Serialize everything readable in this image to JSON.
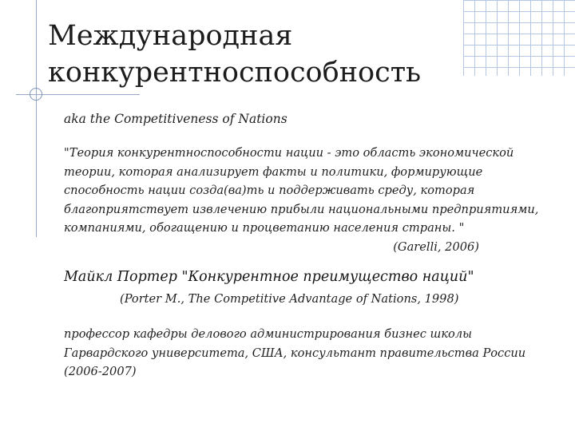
{
  "title": {
    "line1": "Международная",
    "line2": "конкурентноспособность"
  },
  "subtitle": "aka the Competitiveness of Nations",
  "definition": {
    "lines": [
      "\"Теория конкурентноспособности нации - это область экономической",
      "теории, которая анализирует факты и политики, формирующие",
      "способность нации созда(ва)ть и поддерживать среду, которая",
      "благоприятствует извлечению прибыли национальными предприятиями,",
      "компаниями, обогащению и процветанию населения страны. \""
    ],
    "reference": "(Garelli, 2006)"
  },
  "porter": {
    "heading": "Майкл Портер \"Конкурентное преимущество наций\"",
    "reference": "(Porter M., The Competitive Advantage of Nations, 1998)"
  },
  "bio": {
    "lines": [
      "профессор кафедры делового администрирования бизнес школы",
      "Гарвардского университета, США, консультант правительства России",
      "(2006-2007)"
    ]
  },
  "colors": {
    "decor_line": "#98a8c8",
    "grid": "#a9bde0",
    "text": "#1f1f1f"
  }
}
